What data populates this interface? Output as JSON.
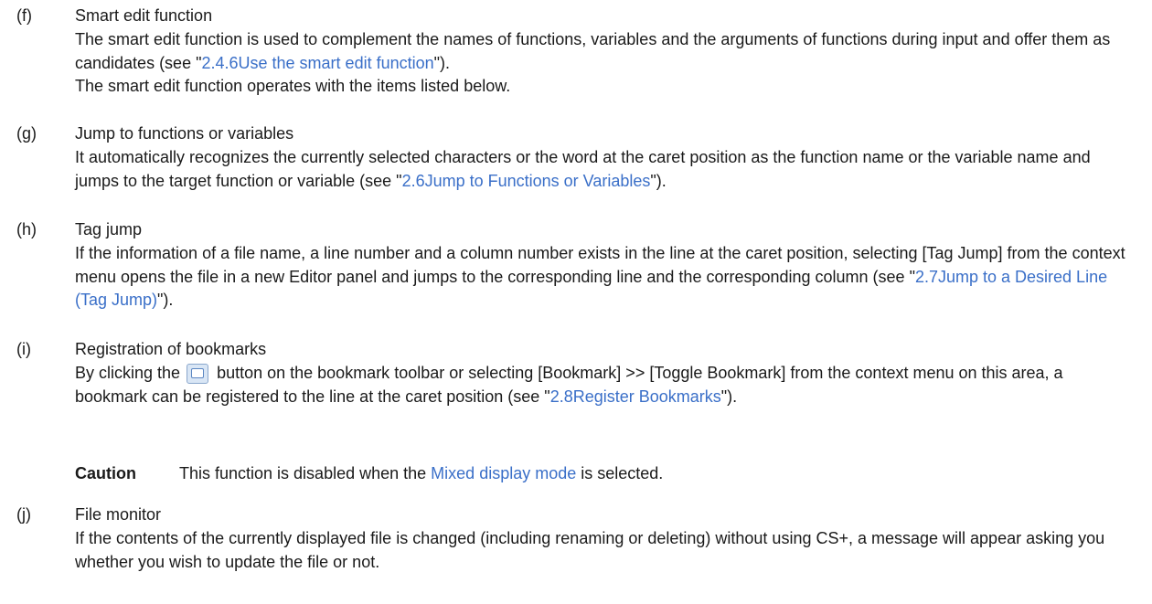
{
  "items": [
    {
      "label": "(f)",
      "title": "Smart edit function",
      "p1_before": "The smart edit function is used to complement the names of functions, variables and the arguments of functions during input and offer them as candidates (see \"",
      "p1_link": "2.4.6Use the smart edit function",
      "p1_after": "\").",
      "p2": "The smart edit function operates with the items listed below."
    },
    {
      "label": "(g)",
      "title": "Jump to functions or variables",
      "before": "It automatically recognizes the currently selected characters or the word at the caret position as the function name or the variable name and jumps to the target function or variable (see \"",
      "link": "2.6Jump to Functions or Variables",
      "after": "\")."
    },
    {
      "label": "(h)",
      "title": "Tag jump",
      "before": "If the information of a file name, a line number and a column number exists in the line at the caret position, selecting [Tag Jump] from the context menu opens the file in a new Editor panel and jumps to the corresponding line and the corresponding column (see \"",
      "link": "2.7Jump to a Desired Line (Tag Jump)",
      "after": "\")."
    },
    {
      "label": "(i)",
      "title": "Registration of bookmarks",
      "before_icon": "By clicking the ",
      "icon": "bookmark-toggle-icon",
      "after_icon": " button on the bookmark toolbar or selecting [Bookmark] >> [Toggle Bookmark] from the context menu on this area, a bookmark can be registered to the line at the caret position (see \"",
      "link": "2.8Register Bookmarks",
      "after": "\").",
      "caution_label": "Caution",
      "caution_before": "This function is disabled when the ",
      "caution_link": "Mixed display mode",
      "caution_after": " is selected."
    },
    {
      "label": "(j)",
      "title": "File monitor",
      "text": "If the contents of the currently displayed file is changed (including renaming or deleting) without using CS+, a message will appear asking you whether you wish to update the file or not."
    }
  ],
  "colors": {
    "text": "#1a1a1a",
    "link": "#3a6fc8"
  }
}
